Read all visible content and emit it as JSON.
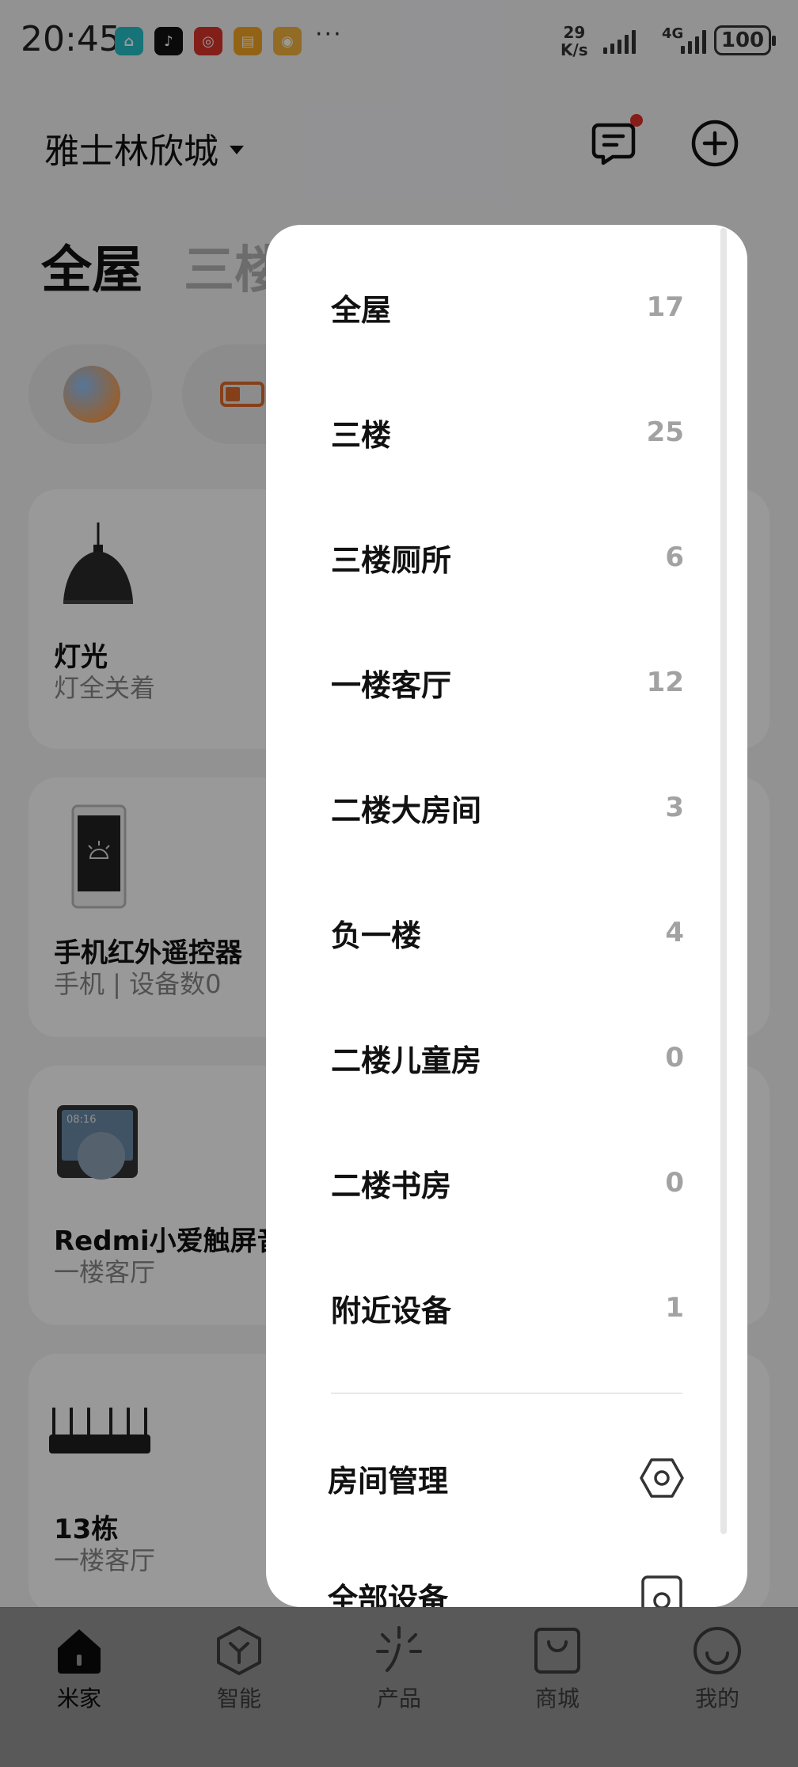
{
  "status_bar": {
    "time": "20:45",
    "net_speed_value": "29",
    "net_speed_unit": "K/s",
    "network_type": "4G",
    "battery": "100",
    "more": "···"
  },
  "header": {
    "home_name": "雅士林欣城"
  },
  "room_tabs": [
    "全屋",
    "三楼"
  ],
  "devices": [
    {
      "title": "灯光",
      "subtitle": "灯全关着"
    },
    {
      "title": "手机红外遥控器",
      "subtitle": "手机 | 设备数0"
    },
    {
      "title": "Redmi小爱触屏音",
      "subtitle": "一楼客厅"
    },
    {
      "title": "13栋",
      "subtitle": "一楼客厅"
    }
  ],
  "screen_clock": "08:16",
  "room_menu": {
    "rooms": [
      {
        "name": "全屋",
        "count": "17"
      },
      {
        "name": "三楼",
        "count": "25"
      },
      {
        "name": "三楼厕所",
        "count": "6"
      },
      {
        "name": "一楼客厅",
        "count": "12"
      },
      {
        "name": "二楼大房间",
        "count": "3"
      },
      {
        "name": "负一楼",
        "count": "4"
      },
      {
        "name": "二楼儿童房",
        "count": "0"
      },
      {
        "name": "二楼书房",
        "count": "0"
      },
      {
        "name": "附近设备",
        "count": "1"
      }
    ],
    "actions": [
      {
        "label": "房间管理",
        "icon": "hexagon-settings-icon"
      },
      {
        "label": "全部设备",
        "icon": "device-icon"
      }
    ]
  },
  "bottom_nav": [
    {
      "label": "米家",
      "icon": "home-icon",
      "active": true
    },
    {
      "label": "智能",
      "icon": "smart-hexagon-icon",
      "active": false
    },
    {
      "label": "产品",
      "icon": "sparkle-icon",
      "active": false
    },
    {
      "label": "商城",
      "icon": "shopping-bag-icon",
      "active": false
    },
    {
      "label": "我的",
      "icon": "smiley-icon",
      "active": false
    }
  ]
}
